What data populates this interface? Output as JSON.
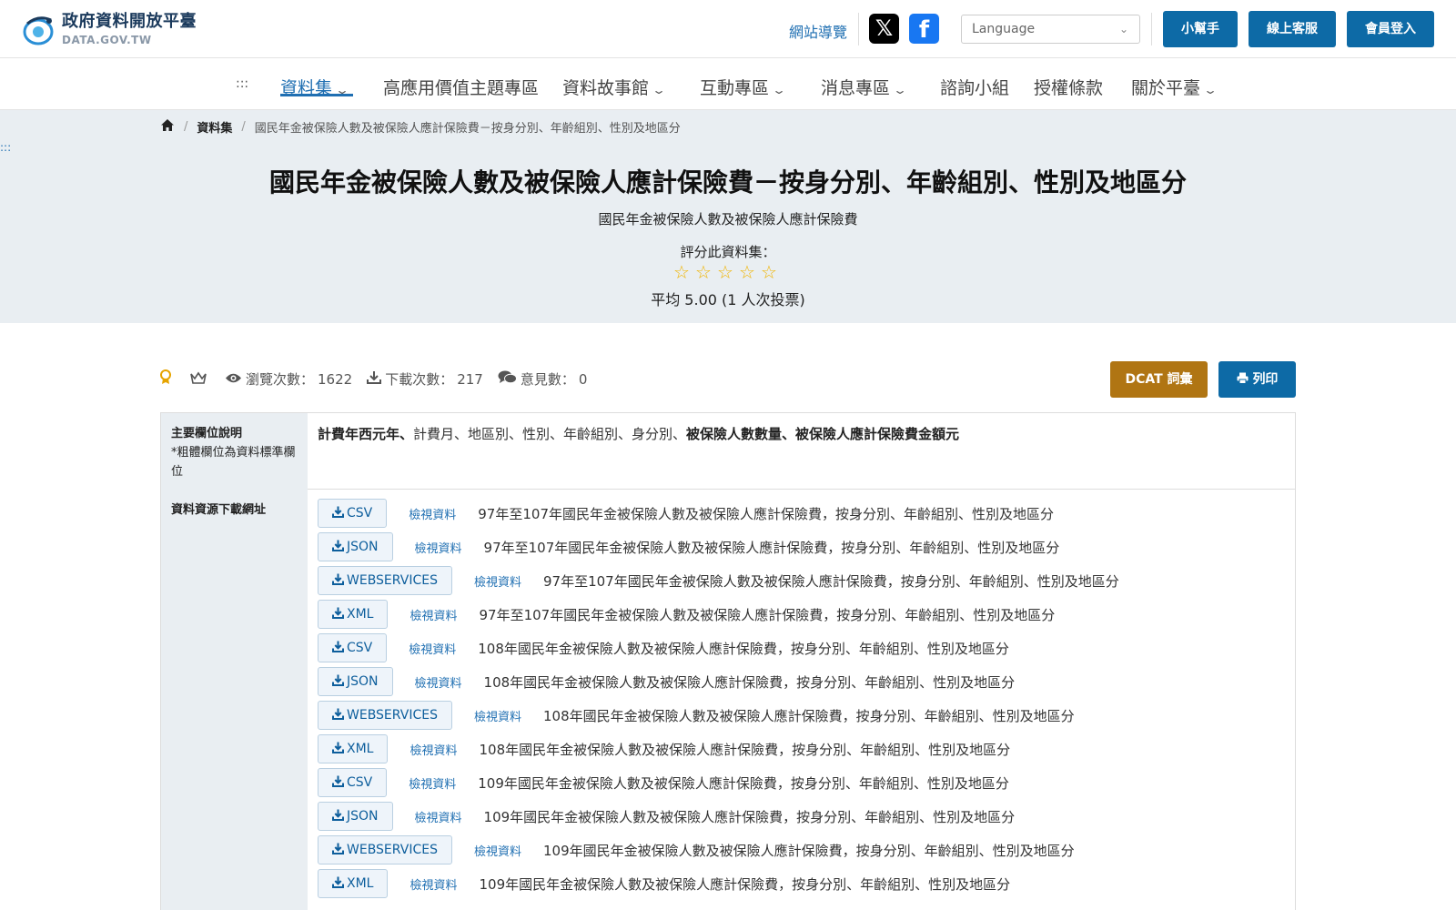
{
  "header": {
    "logo_title": "政府資料開放平臺",
    "logo_sub": "DATA.GOV.TW",
    "site_guide": "網站導覽",
    "x_icon": "x-icon",
    "facebook_icon": "facebook-icon",
    "language_placeholder": "Language",
    "buttons": [
      "小幫手",
      "線上客服",
      "會員登入"
    ],
    "accent_color": "#0d6aa6"
  },
  "nav": {
    "accessibility_mark": ":::",
    "items": [
      {
        "label": "資料集",
        "has_dropdown": true,
        "active": true
      },
      {
        "label": "高應用價值主題專區",
        "has_dropdown": false
      },
      {
        "label": "資料故事館",
        "has_dropdown": true
      },
      {
        "label": "互動專區",
        "has_dropdown": true
      },
      {
        "label": "消息專區",
        "has_dropdown": true
      },
      {
        "label": "諮詢小組",
        "has_dropdown": false
      },
      {
        "label": "授權條款",
        "has_dropdown": false
      },
      {
        "label": "關於平臺",
        "has_dropdown": true
      }
    ]
  },
  "breadcrumb": {
    "home_icon": "home-icon",
    "items": [
      "資料集",
      "國民年金被保險人數及被保險人應計保險費－按身分別、年齡組別、性別及地區分"
    ]
  },
  "side_mark": ":::",
  "dataset": {
    "title": "國民年金被保險人數及被保險人應計保險費－按身分別、年齡組別、性別及地區分",
    "subtitle": "國民年金被保險人數及被保險人應計保險費",
    "rate_label": "評分此資料集：",
    "stars": 5,
    "average_text": "平均 5.00 (1 人次投票)"
  },
  "stats": {
    "views_label": "瀏覽次數：",
    "views": "1622",
    "downloads_label": "下載次數：",
    "downloads": "217",
    "comments_label": "意見數：",
    "comments": "0",
    "dcat_button": "DCAT 詞彙",
    "print_button": "列印"
  },
  "fields": {
    "header_title": "主要欄位說明",
    "header_note": "*粗體欄位為資料標準欄位",
    "bold_lead": "計費年西元年、",
    "plain": "計費月、地區別、性別、年齡組別、身分別、",
    "bold_tail": "被保險人數數量、被保險人應計保險費金額元"
  },
  "resources": {
    "header": "資料資源下載網址",
    "view_label": "檢視資料",
    "items": [
      {
        "format": "CSV",
        "name": "97年至107年國民年金被保險人數及被保險人應計保險費，按身分別、年齡組別、性別及地區分"
      },
      {
        "format": "JSON",
        "name": "97年至107年國民年金被保險人數及被保險人應計保險費，按身分別、年齡組別、性別及地區分"
      },
      {
        "format": "WEBSERVICES",
        "name": "97年至107年國民年金被保險人數及被保險人應計保險費，按身分別、年齡組別、性別及地區分"
      },
      {
        "format": "XML",
        "name": "97年至107年國民年金被保險人數及被保險人應計保險費，按身分別、年齡組別、性別及地區分"
      },
      {
        "format": "CSV",
        "name": "108年國民年金被保險人數及被保險人應計保險費，按身分別、年齡組別、性別及地區分"
      },
      {
        "format": "JSON",
        "name": "108年國民年金被保險人數及被保險人應計保險費，按身分別、年齡組別、性別及地區分"
      },
      {
        "format": "WEBSERVICES",
        "name": "108年國民年金被保險人數及被保險人應計保險費，按身分別、年齡組別、性別及地區分"
      },
      {
        "format": "XML",
        "name": "108年國民年金被保險人數及被保險人應計保險費，按身分別、年齡組別、性別及地區分"
      },
      {
        "format": "CSV",
        "name": "109年國民年金被保險人數及被保險人應計保險費，按身分別、年齡組別、性別及地區分"
      },
      {
        "format": "JSON",
        "name": "109年國民年金被保險人數及被保險人應計保險費，按身分別、年齡組別、性別及地區分"
      },
      {
        "format": "WEBSERVICES",
        "name": "109年國民年金被保險人數及被保險人應計保險費，按身分別、年齡組別、性別及地區分"
      },
      {
        "format": "XML",
        "name": "109年國民年金被保險人數及被保險人應計保險費，按身分別、年齡組別、性別及地區分"
      }
    ]
  }
}
